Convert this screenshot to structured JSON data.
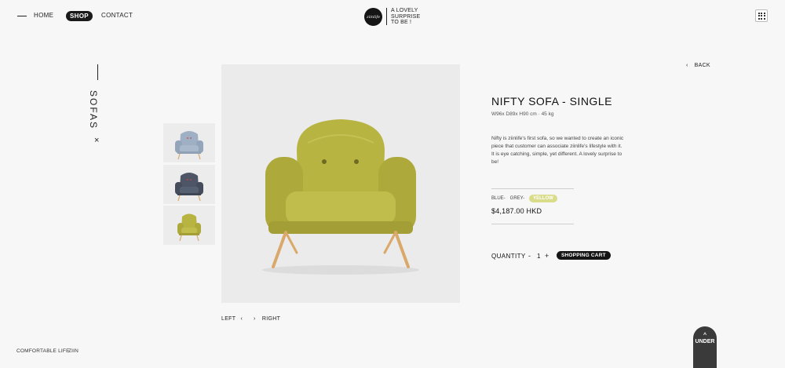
{
  "nav": {
    "home": "HOME",
    "shop": "SHOP",
    "contact": "CONTACT"
  },
  "brand": {
    "logo_text": "ziinlife",
    "tagline": [
      "A LOVELY",
      "SURPRISE",
      "TO BE !"
    ]
  },
  "category": {
    "label": "SOFAS",
    "close": "×"
  },
  "gallery": {
    "prev_label": "LEFT",
    "next_label": "RIGHT",
    "prev_icon": "‹",
    "next_icon": "›",
    "thumbnails": [
      "blue",
      "grey",
      "yellow"
    ]
  },
  "product": {
    "back_label": "BACK",
    "back_icon": "‹",
    "title": "NIFTY SOFA - SINGLE",
    "dimensions": "W96x D89x H90 cm  ·  45 kg",
    "description": "Nifty is ziinlife's first sofa, so we wanted to create an iconic piece that customer can associate ziinlife's lifestyle with it. It is eye catching, simple, yet different. A lovely surprise to be!",
    "colors": [
      {
        "label": "BLUE-",
        "selected": false
      },
      {
        "label": "GREY-",
        "selected": false
      },
      {
        "label": "YELLOW",
        "selected": true
      }
    ],
    "price": "$4,187.00 HKD",
    "quantity_label": "QUANTITY",
    "quantity_minus": "-",
    "quantity_value": "1",
    "quantity_plus": "+",
    "cart_label": "SHOPPING CART"
  },
  "footer": {
    "left_text": "COMFORTABLE LIFE",
    "right_text": "ZIIN",
    "under_label": "UNDER",
    "under_icon": "^"
  },
  "colors": {
    "background": "#f7f7f7",
    "selected_color_chip": "#d9dc8a",
    "sofa_yellow": "#b8b442",
    "sofa_blue": "#9fb0c4",
    "sofa_grey": "#4d5566",
    "wood": "#d9a86a"
  }
}
